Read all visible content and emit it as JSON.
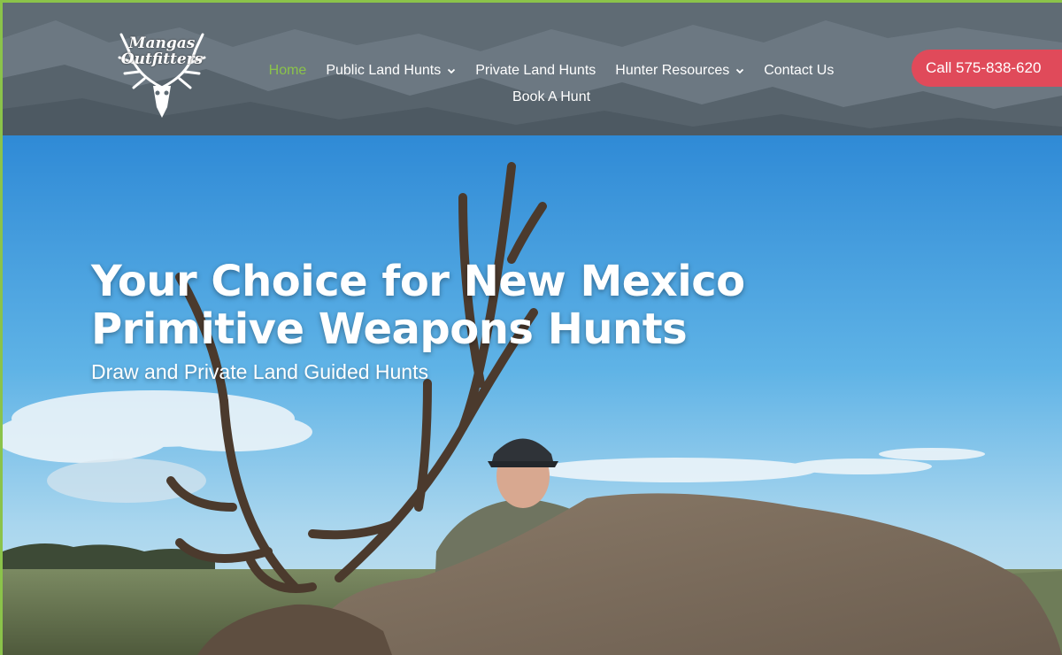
{
  "brand": {
    "logo_line1": "Mangas",
    "logo_line2": "Outfitters",
    "logo_icon": "elk-skull-antlers-icon"
  },
  "nav": {
    "items": [
      {
        "label": "Home",
        "active": true
      },
      {
        "label": "Public Land Hunts",
        "dropdown": true
      },
      {
        "label": "Private Land Hunts"
      },
      {
        "label": "Hunter Resources",
        "dropdown": true
      },
      {
        "label": "Contact Us"
      },
      {
        "label": "Book A Hunt"
      }
    ],
    "active_color": "#8bc34a"
  },
  "call_button": {
    "label": "Call 575-838-620",
    "color": "#e04a5a"
  },
  "hero": {
    "title_line1": "Your Choice for New Mexico",
    "title_line2": "Primitive Weapons Hunts",
    "subtitle": "Draw and Private Land Guided Hunts"
  },
  "colors": {
    "header_bg": "#5f6b74",
    "page_border": "#8bc34a",
    "sky": "#4a9fd8"
  }
}
